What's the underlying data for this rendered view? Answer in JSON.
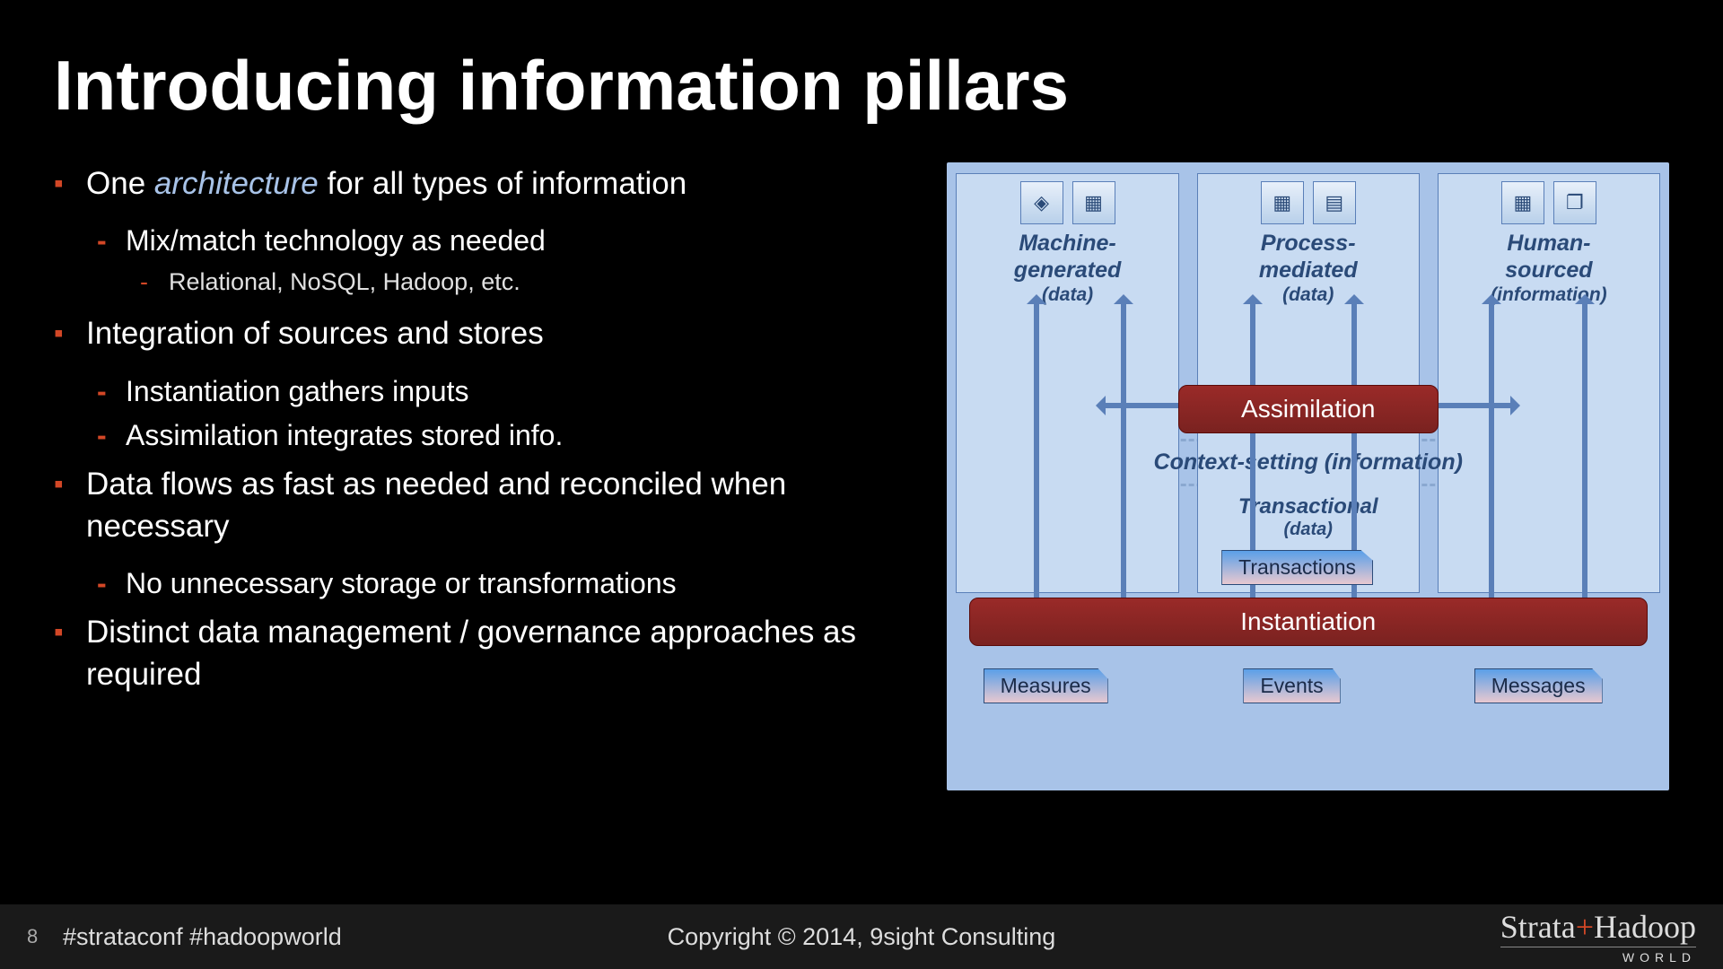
{
  "title": "Introducing information pillars",
  "bullets": [
    {
      "level": 1,
      "pre": "One ",
      "italic": "architecture",
      "post": " for all types of information"
    },
    {
      "level": 2,
      "text": "Mix/match technology as needed"
    },
    {
      "level": 3,
      "text": "Relational, NoSQL, Hadoop, etc."
    },
    {
      "level": 1,
      "text": "Integration of sources and stores"
    },
    {
      "level": 2,
      "text": "Instantiation gathers inputs"
    },
    {
      "level": 2,
      "text": "Assimilation integrates stored info."
    },
    {
      "level": 1,
      "text": "Data flows as fast as needed and reconciled when necessary"
    },
    {
      "level": 2,
      "text": "No unnecessary storage or transformations"
    },
    {
      "level": 1,
      "text": "Distinct data management / governance approaches as required"
    }
  ],
  "pillars": [
    {
      "label": "Machine-generated",
      "sub": "(data)",
      "icons": [
        "◈",
        "▦"
      ]
    },
    {
      "label": "Process-mediated",
      "sub": "(data)",
      "icons": [
        "▦",
        "▤"
      ]
    },
    {
      "label": "Human-sourced",
      "sub": "(information)",
      "icons": [
        "▦",
        "❐"
      ]
    }
  ],
  "labels": {
    "context": "Context-setting (information)",
    "transactional": "Transactional",
    "transactional_sub": "(data)",
    "assimilation": "Assimilation",
    "instantiation": "Instantiation",
    "transactions": "Transactions",
    "measures": "Measures",
    "events": "Events",
    "messages": "Messages"
  },
  "footer": {
    "page": "8",
    "hashtags": "#strataconf   #hadoopworld",
    "copyright": "Copyright © 2014, 9sight Consulting",
    "brand1": "Strata",
    "brandplus": "+",
    "brand2": "Hadoop",
    "brandsub": "WORLD"
  }
}
